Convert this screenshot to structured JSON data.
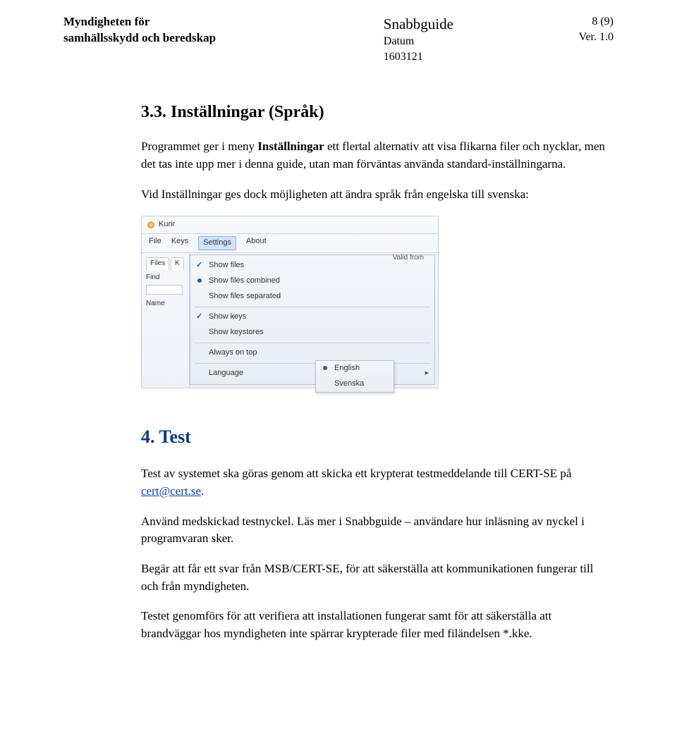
{
  "header": {
    "org_line1": "Myndigheten för",
    "org_line2": "samhällsskydd och beredskap",
    "doc_title": "Snabbguide",
    "date_label": "Datum",
    "date_value": "1603121",
    "page_num": "8 (9)",
    "ver": "Ver. 1.0"
  },
  "section33": {
    "title": "3.3.  Inställningar (Språk)",
    "p1_a": "Programmet ger i meny ",
    "p1_b": "Inställningar",
    "p1_c": " ett flertal alternativ att visa flikarna filer och nycklar, men det tas inte upp mer i denna guide, utan man förväntas använda standard-inställningarna.",
    "p2": "Vid Inställningar ges dock möjligheten att ändra språk från engelska till svenska:"
  },
  "screenshot": {
    "title": "Kurir",
    "menu": {
      "file": "File",
      "keys": "Keys",
      "settings": "Settings",
      "about": "About"
    },
    "left": {
      "tab_files": "Files",
      "tab_k": "K",
      "find": "Find",
      "name": "Name"
    },
    "dropdown": {
      "show_files": "Show files",
      "show_files_combined": "Show files combined",
      "show_files_separated": "Show files separated",
      "show_keys": "Show keys",
      "show_keystores": "Show keystores",
      "always_on_top": "Always on top",
      "language": "Language",
      "valid_from": "Valid from"
    },
    "submenu": {
      "english": "English",
      "svenska": "Svenska"
    }
  },
  "section4": {
    "title": "4. Test",
    "p1_a": "Test av systemet ska göras genom att skicka ett krypterat testmeddelande till CERT-SE på ",
    "p1_link": "cert@cert.se",
    "p1_b": ".",
    "p2": "Använd medskickad testnyckel. Läs mer i Snabbguide – användare hur inläsning av nyckel i programvaran sker.",
    "p3": "Begär att får ett svar från MSB/CERT-SE, för att säkerställa att kommunikationen fungerar till och från myndigheten.",
    "p4": "Testet genomförs för att verifiera att installationen fungerar samt för att säkerställa att brandväggar hos myndigheten inte spärrar krypterade filer med filändelsen *.kke."
  }
}
